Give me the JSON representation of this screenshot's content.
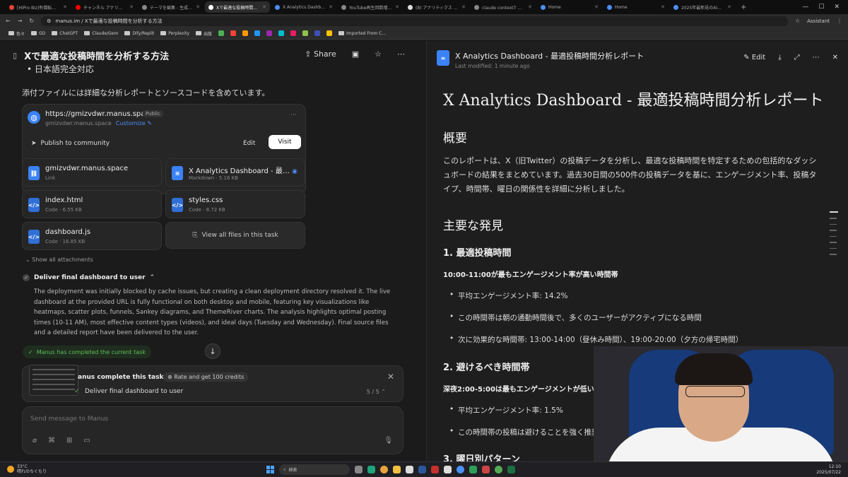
{
  "tabs": [
    {
      "label": "[HiPro Biz]有償転合香・業務",
      "color": "#ea4335",
      "active": false
    },
    {
      "label": "チャンネル アナリティクス - YouTube",
      "color": "#ff0000",
      "active": false
    },
    {
      "label": "テーマを編集 - 生成AIビジネス",
      "color": "#888888",
      "active": false
    },
    {
      "label": "Xで最適な投稿時間を分析する方",
      "color": "#ffffff",
      "active": true
    },
    {
      "label": "X Analytics Dashboard - Opti",
      "color": "#4c8ff5",
      "active": false
    },
    {
      "label": "YouTube再生回数増加傾向の",
      "color": "#888888",
      "active": false
    },
    {
      "label": "(8) アナリティクス / X",
      "color": "#dddddd",
      "active": false
    },
    {
      "label": "claude context7 追加コマンド",
      "color": "#888888",
      "active": false
    },
    {
      "label": "Home",
      "color": "#4c8ff5",
      "active": false
    },
    {
      "label": "Home",
      "color": "#4c8ff5",
      "active": false
    },
    {
      "label": "2025年最新見のAIエージェント",
      "color": "#4c8ff5",
      "active": false
    }
  ],
  "address": {
    "url": "manus.im / Xで最適な投稿時間を分析する方法",
    "assistant": "Assistant"
  },
  "bookmarks": [
    "色々",
    "GD",
    "ChatGPT",
    "Claude/Gem",
    "Dify/Replit",
    "Perplexity",
    "出版",
    "Imported From C..."
  ],
  "left": {
    "title": "Xで最適な投稿時間を分析する方法",
    "share": "Share",
    "bullet": "日本語完全対応",
    "attach_note": "添付ファイルには詳細な分析レポートとソースコードを含めています。",
    "site": {
      "url": "https://gmizvdwr.manus.space",
      "public": "Public",
      "sub": "gmizvdwr.manus.space",
      "customize": "Customize",
      "publish": "Publish to community",
      "edit": "Edit",
      "visit": "Visit"
    },
    "files": [
      {
        "name": "gmizvdwr.manus.space",
        "meta": "Link"
      },
      {
        "name": "X Analytics Dashboard - 最適...",
        "meta": "Markdown · 5.16 KB"
      },
      {
        "name": "index.html",
        "meta": "Code · 6.55 KB"
      },
      {
        "name": "styles.css",
        "meta": "Code · 8.72 KB"
      },
      {
        "name": "dashboard.js",
        "meta": "Code · 16.85 KB"
      }
    ],
    "view_all": "View all files in this task",
    "show_all": "Show all attachments",
    "step": "Deliver final dashboard to user",
    "para": "The deployment was initially blocked by cache issues, but creating a clean deployment directory resolved it. The live dashboard at the provided URL is fully functional on both desktop and mobile, featuring key visualizations like heatmaps, scatter plots, funnels, Sankey diagrams, and ThemeRiver charts. The analysis highlights optimal posting times (10-11 AM), most effective content types (videos), and ideal days (Tuesday and Wednesday). Final source files and a detailed report have been delivered to the user.",
    "done": "Manus has completed the current task",
    "rate_q": "anus complete this task?",
    "credits": "Rate and get 100 credits",
    "rate_task": "Deliver final dashboard to user",
    "progress": "5 / 5",
    "placeholder": "Send message to Manus"
  },
  "right": {
    "doc_title": "X Analytics Dashboard - 最適投稿時間分析レポート",
    "modified": "Last modified: 1 minute ago",
    "edit": "Edit",
    "h1": "X Analytics Dashboard - 最適投稿時間分析レポート",
    "overview": "概要",
    "overview_text": "このレポートは、X（旧Twitter）の投稿データを分析し、最適な投稿時間を特定するための包括的なダッシュボードの結果をまとめています。過去30日間の500件の投稿データを基に、エンゲージメント率、投稿タイプ、時間帯、曜日の関係性を詳細に分析しました。",
    "findings": "主要な発見",
    "s1": "1. 最適投稿時間",
    "s1_strong": "10:00-11:00が最もエンゲージメント率が高い時間帯",
    "s1_items": [
      "平均エンゲージメント率: 14.2%",
      "この時間帯は朝の通勤時間後で、多くのユーザーがアクティブになる時間",
      "次に効果的な時間帯: 13:00-14:00（昼休み時間）、19:00-20:00（夕方の帰宅時間）"
    ],
    "s2": "2. 避けるべき時間帯",
    "s2_strong": "深夜2:00-5:00は最もエンゲージメントが低い",
    "s2_items": [
      "平均エンゲージメント率: 1.5%",
      "この時間帯の投稿は避けることを強く推奨"
    ],
    "s3": "3. 曜日別パターン"
  },
  "taskbar": {
    "temp": "33°C",
    "weather": "晴れのちくもり",
    "search": "検索",
    "time": "12:10",
    "date": "2025/07/22"
  }
}
